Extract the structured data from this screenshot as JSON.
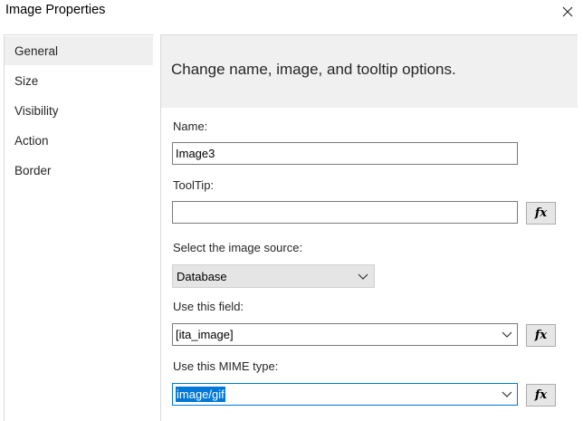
{
  "window": {
    "title": "Image Properties",
    "close_icon": "close-icon"
  },
  "sidebar": {
    "items": [
      {
        "label": "General",
        "selected": true
      },
      {
        "label": "Size",
        "selected": false
      },
      {
        "label": "Visibility",
        "selected": false
      },
      {
        "label": "Action",
        "selected": false
      },
      {
        "label": "Border",
        "selected": false
      }
    ]
  },
  "main": {
    "header": "Change name, image, and tooltip options.",
    "name": {
      "label": "Name:",
      "value": "Image3"
    },
    "tooltip": {
      "label": "ToolTip:",
      "value": "",
      "fx_label": "fx"
    },
    "image_source": {
      "label": "Select the image source:",
      "value": "Database"
    },
    "field": {
      "label": "Use this field:",
      "value": "[ita_image]",
      "fx_label": "fx"
    },
    "mime": {
      "label": "Use this MIME type:",
      "value": "image/gif",
      "fx_label": "fx"
    }
  },
  "colors": {
    "selection": "#0078d7",
    "header_bg": "#f0f0f0",
    "nav_selected_bg": "#efefef",
    "dropdown_bg": "#e5e5e5",
    "fx_button_bg": "#e6e6e6"
  }
}
